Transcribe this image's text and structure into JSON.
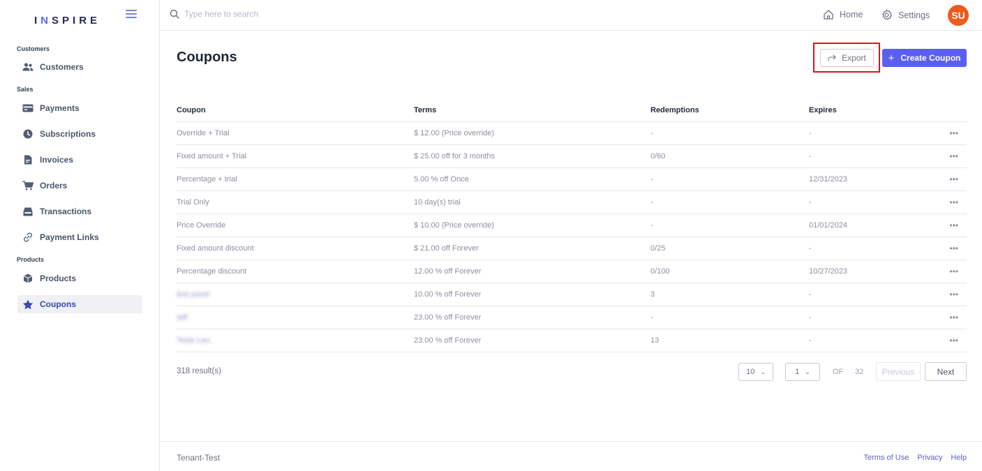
{
  "brand": {
    "prefix": "I",
    "accent": "N",
    "suffix": "SPIRE"
  },
  "sidebar": {
    "sections": [
      {
        "label": "Customers"
      },
      {
        "label": "Sales"
      },
      {
        "label": "Products"
      }
    ],
    "items": [
      {
        "label": "Customers",
        "icon": "users-icon"
      },
      {
        "label": "Payments",
        "icon": "credit-card-icon"
      },
      {
        "label": "Subscriptions",
        "icon": "clock-icon"
      },
      {
        "label": "Invoices",
        "icon": "document-icon"
      },
      {
        "label": "Orders",
        "icon": "cart-icon"
      },
      {
        "label": "Transactions",
        "icon": "inbox-icon"
      },
      {
        "label": "Payment Links",
        "icon": "link-icon"
      },
      {
        "label": "Products",
        "icon": "box-icon"
      },
      {
        "label": "Coupons",
        "icon": "star-icon",
        "active": true
      }
    ]
  },
  "topbar": {
    "search_placeholder": "Type here to search",
    "home_label": "Home",
    "settings_label": "Settings",
    "avatar_initials": "SU",
    "avatar_color": "#f05a1b"
  },
  "page": {
    "title": "Coupons",
    "export_label": "Export",
    "create_label": "Create Coupon",
    "accent_color": "#5b5ff0",
    "highlight_color": "#e0111c"
  },
  "table": {
    "columns": [
      "Coupon",
      "Terms",
      "Redemptions",
      "Expires"
    ],
    "rows": [
      {
        "coupon": "Override + Trial",
        "terms": "$ 12.00 (Price override)",
        "redemptions": "-",
        "expires": "-",
        "blurred": false
      },
      {
        "coupon": "Fixed amount + Trial",
        "terms": "$ 25.00 off for 3 months",
        "redemptions": "0/60",
        "expires": "-",
        "blurred": false
      },
      {
        "coupon": "Percentage + trial",
        "terms": "5.00 % off Once",
        "redemptions": "-",
        "expires": "12/31/2023",
        "blurred": false
      },
      {
        "coupon": "Trial Only",
        "terms": "10 day(s) trial",
        "redemptions": "-",
        "expires": "-",
        "blurred": false
      },
      {
        "coupon": "Price Override",
        "terms": "$ 10.00 (Price override)",
        "redemptions": "-",
        "expires": "01/01/2024",
        "blurred": false
      },
      {
        "coupon": "Fixed amount discount",
        "terms": "$ 21.00 off Forever",
        "redemptions": "0/25",
        "expires": "-",
        "blurred": false
      },
      {
        "coupon": "Percentage discount",
        "terms": "12.00 % off Forever",
        "redemptions": "0/100",
        "expires": "10/27/2023",
        "blurred": false
      },
      {
        "coupon": "test pavel",
        "terms": "10.00 % off Forever",
        "redemptions": "3",
        "expires": "-",
        "blurred": true
      },
      {
        "coupon": "adf",
        "terms": "23.00 % off Forever",
        "redemptions": "-",
        "expires": "-",
        "blurred": true
      },
      {
        "coupon": "Teste Leo",
        "terms": "23.00 % off Forever",
        "redemptions": "13",
        "expires": "-",
        "blurred": true
      }
    ],
    "row_menu": "•••"
  },
  "pagination": {
    "results": "318 result(s)",
    "page_size": "10",
    "current_page": "1",
    "of_label": "OF",
    "total_pages": "32",
    "previous_label": "Previous",
    "next_label": "Next"
  },
  "footer": {
    "tenant": "Tenant-Test",
    "links": [
      "Terms of Use",
      "Privacy",
      "Help"
    ]
  }
}
